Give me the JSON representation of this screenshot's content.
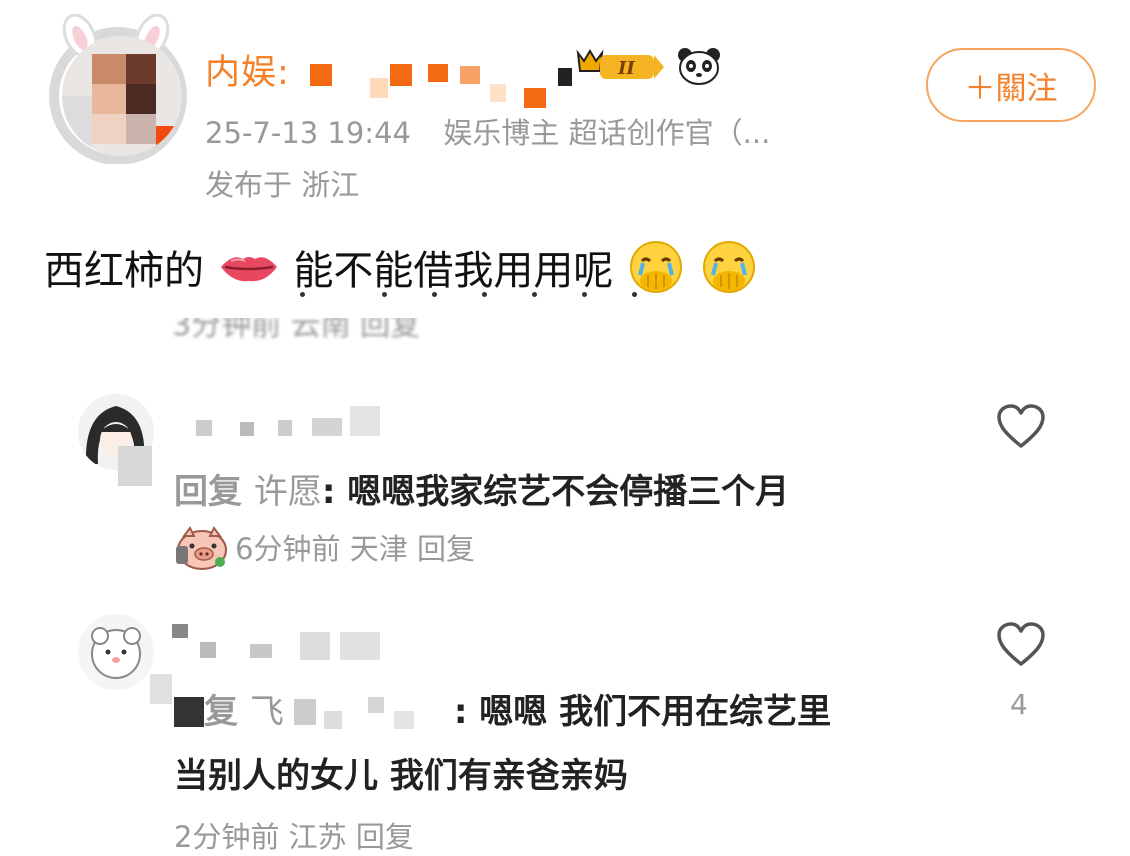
{
  "post": {
    "author_name": "内娱:",
    "badge_label": "II",
    "timestamp": "25-7-13 19:44",
    "source": "娱乐博主 超话创作官（...",
    "location": "发布于 浙江",
    "follow_label": "＋關注",
    "text_part1": "西红柿的",
    "text_part2": "能不能借我用用呢"
  },
  "cropped_line": "3分钟前 云南 回复",
  "comments": [
    {
      "reply_prefix": "回复",
      "reply_target": "许愿",
      "colon": ":",
      "line1": "嗯嗯我家综艺不会停播三个月",
      "meta": "6分钟前 天津 回复",
      "like_count": ""
    },
    {
      "reply_prefix": "复",
      "reply_target": "飞",
      "colon": ":",
      "line1": "嗯嗯 我们不用在综艺里",
      "line2": "当别人的女儿 我们有亲爸亲妈",
      "meta": "2分钟前 江苏 回复",
      "like_count": "4"
    }
  ],
  "icons": {
    "heart": "heart-outline-icon",
    "lips": "lips-emoji-icon",
    "crying": "crying-face-emoji-icon",
    "panda": "panda-icon",
    "crown": "crown-badge-icon",
    "pig": "pig-sticker-icon"
  },
  "colors": {
    "author_orange": "#f3822a",
    "follow_border": "#f5a55e",
    "meta_gray": "#999999"
  }
}
